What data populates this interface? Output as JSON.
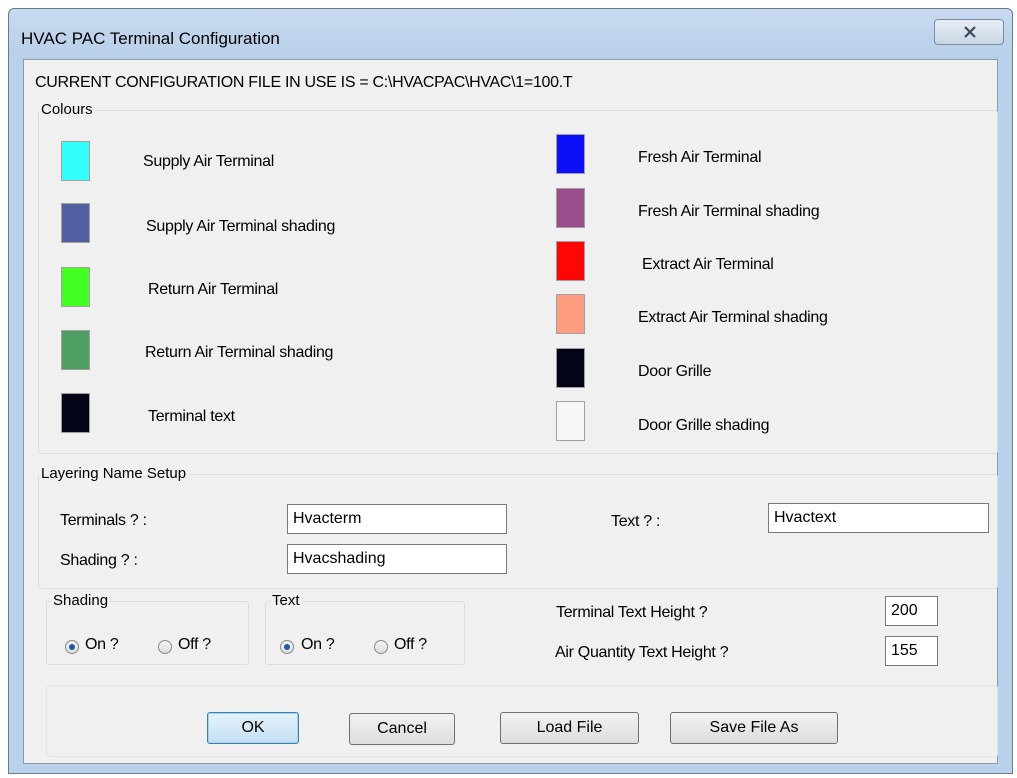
{
  "window": {
    "title": "HVAC PAC Terminal Configuration",
    "close_icon": "close-x-icon"
  },
  "config_file_line": "CURRENT  CONFIGURATION  FILE  IN  USE  IS =  C:\\HVACPAC\\HVAC\\1=100.T",
  "colours": {
    "legend": "Colours",
    "left": [
      {
        "label": "Supply Air Terminal",
        "color": "#33ffff"
      },
      {
        "label": "Supply Air Terminal shading",
        "color": "#5060a0"
      },
      {
        "label": "Return Air Terminal",
        "color": "#44ff22"
      },
      {
        "label": "Return Air Terminal shading",
        "color": "#4f9e62"
      },
      {
        "label": "Terminal text",
        "color": "#040418"
      }
    ],
    "right": [
      {
        "label": "Fresh Air Terminal",
        "color": "#0c10f8"
      },
      {
        "label": "Fresh Air Terminal shading",
        "color": "#9a4e8e"
      },
      {
        "label": "Extract Air Terminal",
        "color": "#ff0606"
      },
      {
        "label": "Extract Air Terminal shading",
        "color": "#ff9d80"
      },
      {
        "label": "Door Grille",
        "color": "#040418"
      },
      {
        "label": "Door Grille shading",
        "color": "#f7f7f7"
      }
    ]
  },
  "layering": {
    "legend": "Layering Name Setup",
    "terminals_label": "Terminals  ? :",
    "terminals_value": "Hvacterm",
    "shading_label": "Shading ? :",
    "shading_value": "Hvacshading",
    "text_label": "Text ? :",
    "text_value": "Hvactext"
  },
  "shading_group": {
    "legend": "Shading",
    "on_label": "On  ?",
    "off_label": "Off ?",
    "selected": "on"
  },
  "text_group": {
    "legend": "Text",
    "on_label": "On  ?",
    "off_label": "Off ?",
    "selected": "on"
  },
  "heights": {
    "terminal_label": "Terminal Text Height     ?",
    "terminal_value": "200",
    "air_quantity_label": "Air Quantity Text Height ?",
    "air_quantity_value": "155"
  },
  "buttons": {
    "ok": "OK",
    "cancel": "Cancel",
    "load": "Load  File",
    "save_as": "Save File As"
  }
}
